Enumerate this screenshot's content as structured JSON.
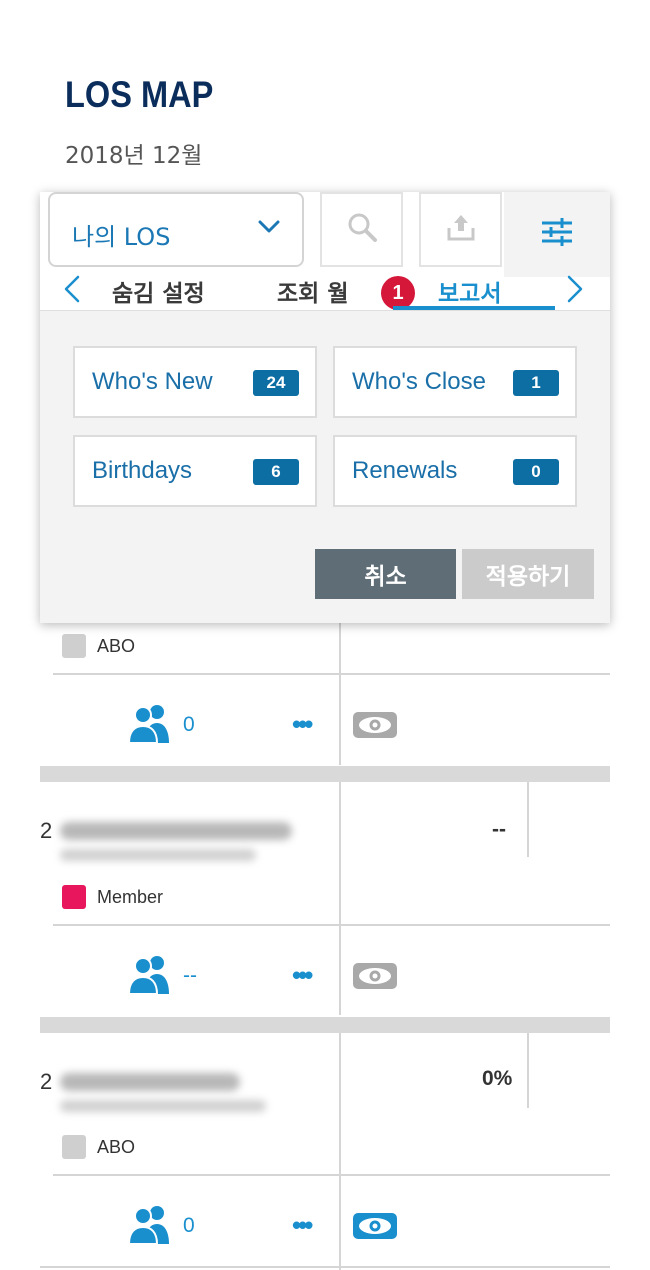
{
  "header": {
    "title": "LOS MAP",
    "period": "2018년 12월"
  },
  "toolbar": {
    "scope_select": {
      "value": "나의 LOS",
      "icon": "chevron-down-icon"
    },
    "search_icon": "search-icon",
    "share_icon": "share-upload-icon",
    "filter_icon": "sliders-icon"
  },
  "tabs": {
    "items": [
      {
        "label": "숨김 설정",
        "active": false
      },
      {
        "label": "조회 월",
        "active": false
      },
      {
        "label": "보고서",
        "active": true,
        "badge": "1"
      }
    ]
  },
  "reports": [
    {
      "label": "Who's New",
      "count": "24"
    },
    {
      "label": "Who's Close",
      "count": "1"
    },
    {
      "label": "Birthdays",
      "count": "6"
    },
    {
      "label": "Renewals",
      "count": "0"
    }
  ],
  "actions": {
    "cancel": "취소",
    "apply": "적용하기"
  },
  "list": {
    "rows": [
      {
        "type": "ABO",
        "downline_count": "0",
        "eye_state": "inactive"
      },
      {
        "rank": "2",
        "value": "--",
        "type": "Member",
        "downline_count": "--",
        "eye_state": "inactive"
      },
      {
        "rank": "2",
        "value": "0%",
        "type": "ABO",
        "downline_count": "0",
        "eye_state": "active"
      }
    ]
  },
  "colors": {
    "accent": "#1a8fce",
    "title": "#0b2d5b",
    "badge": "#d5173a",
    "member": "#e8175d",
    "cancel": "#5e6d76"
  }
}
